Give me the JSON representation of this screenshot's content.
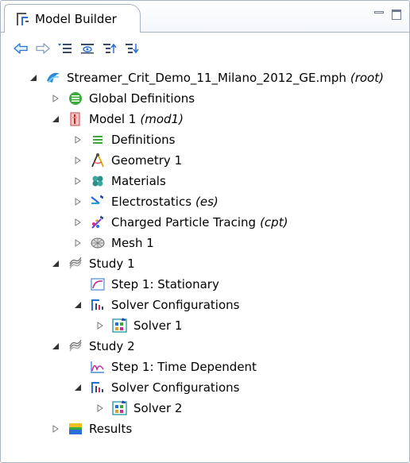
{
  "panel": {
    "title": "Model Builder"
  },
  "icons": {
    "panel": "model-builder-icon",
    "toolbar": [
      "back-arrow-icon",
      "forward-arrow-icon",
      "show-more-options-icon",
      "show-filter-icon",
      "collapse-all-icon",
      "expand-all-icon"
    ]
  },
  "tree": {
    "root": {
      "label": "Streamer_Crit_Demo_11_Milano_2012_GE.mph",
      "tag": "(root)"
    },
    "global_definitions": {
      "label": "Global Definitions"
    },
    "model1": {
      "label": "Model 1",
      "tag": "(mod1)"
    },
    "definitions": {
      "label": "Definitions"
    },
    "geometry1": {
      "label": "Geometry 1"
    },
    "materials": {
      "label": "Materials"
    },
    "electrostatics": {
      "label": "Electrostatics",
      "tag": "(es)"
    },
    "charged_particle_tracing": {
      "label": "Charged Particle Tracing",
      "tag": "(cpt)"
    },
    "mesh1": {
      "label": "Mesh 1"
    },
    "study1": {
      "label": "Study 1"
    },
    "study1_step1": {
      "label": "Step 1: Stationary"
    },
    "study1_solver_configs": {
      "label": "Solver Configurations"
    },
    "solver1": {
      "label": "Solver 1"
    },
    "study2": {
      "label": "Study 2"
    },
    "study2_step1": {
      "label": "Step 1: Time Dependent"
    },
    "study2_solver_configs": {
      "label": "Solver Configurations"
    },
    "solver2": {
      "label": "Solver 2"
    },
    "results": {
      "label": "Results"
    }
  },
  "colors": {
    "accent": "#2a6fd6",
    "arrow_green": "#3aaa3a",
    "border": "#a9b4c2"
  }
}
